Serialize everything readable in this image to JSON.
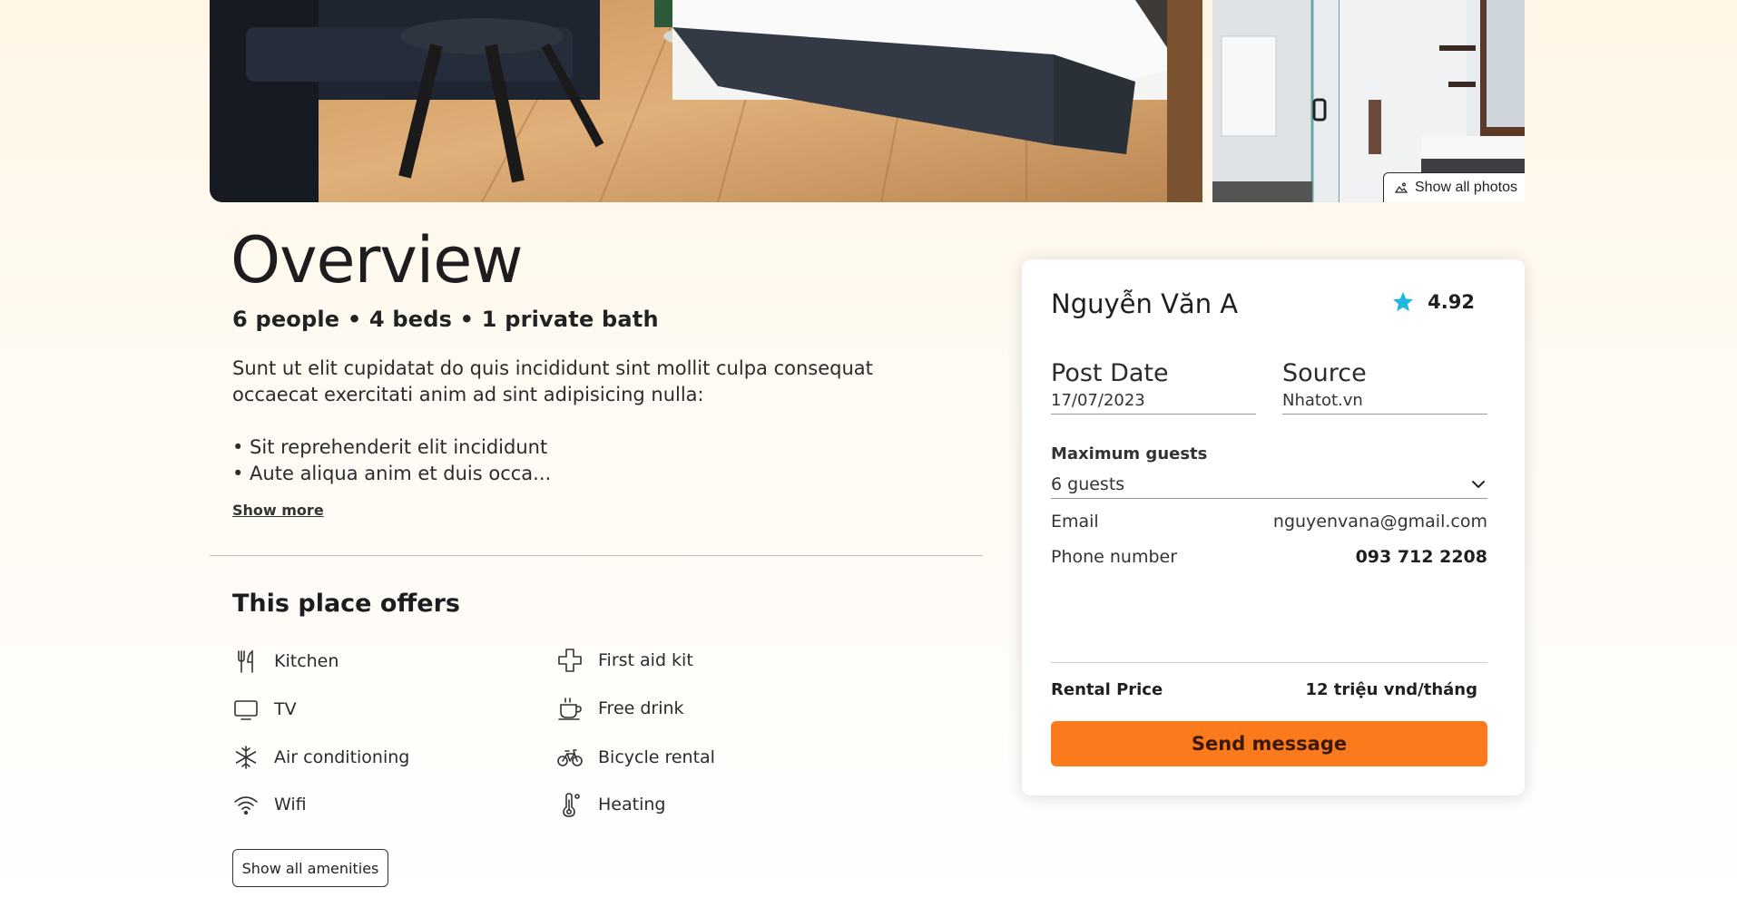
{
  "gallery": {
    "show_all_photos_label": "Show all photos"
  },
  "overview": {
    "title": "Overview",
    "summary": "6 people • 4 beds • 1 private bath",
    "description": "Sunt ut elit cupidatat do quis incididunt sint mollit culpa consequat occaecat exercitati anim ad sint adipisicing nulla:",
    "bullets": [
      "• Sit reprehenderit elit incididunt",
      "• Aute aliqua anim et duis occa..."
    ],
    "show_more_label": "Show more"
  },
  "amenities": {
    "title": "This place offers",
    "items": [
      {
        "label": "Kitchen",
        "icon": "utensils-icon"
      },
      {
        "label": "TV",
        "icon": "tv-icon"
      },
      {
        "label": "Air conditioning",
        "icon": "snowflake-icon"
      },
      {
        "label": "Wifi",
        "icon": "wifi-icon"
      },
      {
        "label": "First aid kit",
        "icon": "medical-cross-icon"
      },
      {
        "label": "Free drink",
        "icon": "coffee-cup-icon"
      },
      {
        "label": "Bicycle rental",
        "icon": "bicycle-icon"
      },
      {
        "label": "Heating",
        "icon": "thermometer-icon"
      }
    ],
    "show_all_label": "Show all amenities"
  },
  "contact_card": {
    "owner_name": "Nguyễn Văn A",
    "rating": "4.92",
    "post_date": {
      "label": "Post Date",
      "value": "17/07/2023"
    },
    "source": {
      "label": "Source",
      "value": "Nhatot.vn"
    },
    "max_guests": {
      "label": "Maximum guests",
      "value": "6 guests"
    },
    "email": {
      "label": "Email",
      "value": "nguyenvana@gmail.com"
    },
    "phone": {
      "label": "Phone number",
      "value": "093 712 2208"
    },
    "rental_price": {
      "label": "Rental Price",
      "value": "12 triệu vnd/tháng"
    },
    "send_button_label": "Send message"
  },
  "colors": {
    "accent": "#fd7a1c",
    "star": "#1fb6e0"
  }
}
